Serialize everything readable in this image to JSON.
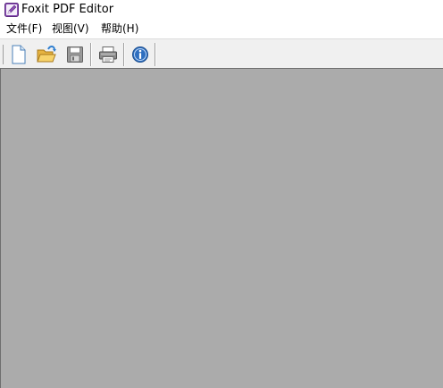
{
  "window": {
    "title": "Foxit PDF Editor",
    "app_icon": "foxit-pen-icon"
  },
  "menubar": {
    "items": [
      {
        "label": "文件(F)"
      },
      {
        "label": "视图(V)"
      },
      {
        "label": "帮助(H)"
      }
    ]
  },
  "toolbar": {
    "buttons": [
      {
        "icon": "new-document-icon"
      },
      {
        "icon": "open-folder-icon"
      },
      {
        "icon": "save-disk-icon"
      },
      {
        "icon": "printer-icon"
      },
      {
        "icon": "info-icon"
      }
    ]
  },
  "colors": {
    "workspace": "#ababab",
    "toolbar": "#f0f0f0",
    "accent": "#7b3fa0"
  }
}
